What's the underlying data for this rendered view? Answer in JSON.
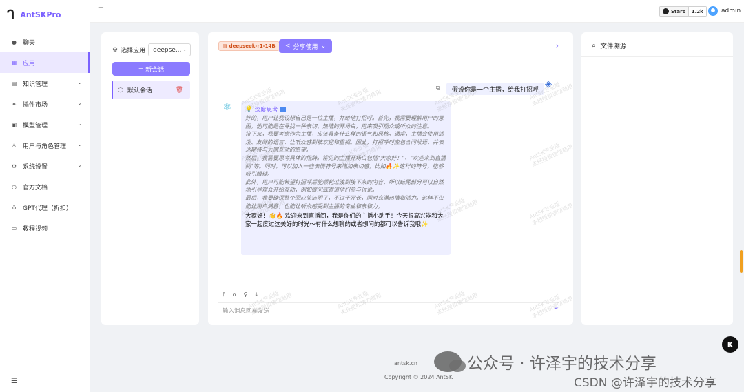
{
  "app": {
    "logo_mark": "ᒉ",
    "name": "AntSKPro"
  },
  "sidebar": {
    "items": [
      {
        "label": "聊天",
        "icon": "chat-icon",
        "expandable": false,
        "active": false
      },
      {
        "label": "应用",
        "icon": "app-icon",
        "expandable": false,
        "active": true
      },
      {
        "label": "知识管理",
        "icon": "knowledge-icon",
        "expandable": true,
        "active": false
      },
      {
        "label": "插件市场",
        "icon": "plugin-icon",
        "expandable": true,
        "active": false
      },
      {
        "label": "模型管理",
        "icon": "model-icon",
        "expandable": true,
        "active": false
      },
      {
        "label": "用户与角色管理",
        "icon": "users-icon",
        "expandable": true,
        "active": false
      },
      {
        "label": "系统设置",
        "icon": "settings-icon",
        "expandable": true,
        "active": false
      },
      {
        "label": "官方文档",
        "icon": "docs-icon",
        "expandable": false,
        "active": false
      },
      {
        "label": "GPT代理（折扣）",
        "icon": "gpt-proxy-icon",
        "expandable": false,
        "active": false
      },
      {
        "label": "教程视频",
        "icon": "video-icon",
        "expandable": false,
        "active": false
      }
    ],
    "collapse_icon": "menu-fold-icon"
  },
  "header": {
    "github": {
      "label": "Stars",
      "count": "1.2k"
    },
    "user": {
      "name": "admin"
    }
  },
  "left_panel": {
    "select_label": "选择应用",
    "select_value": "deepse...",
    "new_conversation": "新会话",
    "conversations": [
      {
        "label": "默认会话",
        "active": true
      }
    ]
  },
  "chat": {
    "model_tag": "deepseek-r1-14B",
    "share_label": "分享使用",
    "user_message": "假设你是一个主播，给我打招呼",
    "assistant": {
      "think_title": "深度思考",
      "think_paragraphs": [
        "好的，用户让我设想自己是一位主播，并给他打招呼。首先，我需要理解用户的意图。他可能是在寻找一种亲切、热情的开场白，用来吸引观众或听众的注意。",
        "接下来，我要考虑作为主播，应该具备什么样的语气和风格。通常，主播会使用活泼、友好的语言，让听众感到被欢迎和重视。因此，打招呼时应包含问候语，并表达期待与大家互动的愿望。",
        "然后，我需要思考具体的措辞。常见的主播开场白包括\"大家好！\"、\"欢迎来到直播间\"等。同时，可以加入一些表情符号来增加亲切感，比如🔥✨这样的符号，能够吸引眼球。",
        "此外，用户可能希望打招呼后能顺利过渡到接下来的内容，所以结尾部分可以自然地引导观众开始互动，例如提问或邀请他们参与讨论。",
        "最后，我要确保整个回应简洁明了，不过于冗长，同时充满热情和活力。这样不仅能让用户满意，也能让听众感受到主播的专业和亲和力。"
      ],
      "answer": "大家好！👋🔥 欢迎来到直播间，我是你们的主播小助手！今天很高兴能和大家一起度过这美好的时光～有什么想聊的或者想问的都可以告诉我哦✨"
    },
    "tools": [
      "upload-icon",
      "bank-icon",
      "bulb-icon",
      "download-icon"
    ],
    "input_placeholder": "输入消息回车发送"
  },
  "file_panel": {
    "title": "文件溯源"
  },
  "watermark": {
    "line1": "AntSK专业版",
    "line2": "未经授权请勿商用"
  },
  "footer": {
    "site": "antsk.cn",
    "copyright": "Copyright © 2024 AntSK"
  },
  "overlay": {
    "wechat_text": "公众号 · 许泽宇的技术分享",
    "csdn_text": "CSDN @许泽宇的技术分享",
    "floating_button": "K"
  }
}
